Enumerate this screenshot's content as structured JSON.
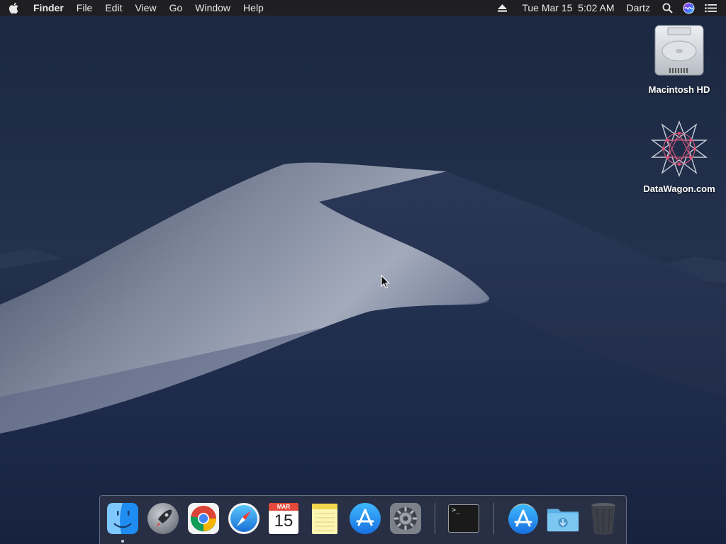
{
  "menubar": {
    "app_name": "Finder",
    "menus": [
      "File",
      "Edit",
      "View",
      "Go",
      "Window",
      "Help"
    ],
    "clock": "Tue Mar 15  5:02 AM",
    "user": "Dartz",
    "icons": [
      "apple-icon",
      "eject-icon",
      "spotlight-search-icon",
      "siri-icon",
      "notification-center-icon"
    ]
  },
  "desktop": {
    "icons": [
      {
        "label": "Macintosh HD",
        "icon": "hard-drive-icon"
      },
      {
        "label": "DataWagon.com",
        "icon": "network-volume-icon"
      }
    ]
  },
  "dock": {
    "items": [
      {
        "name": "Finder",
        "icon": "finder-icon",
        "running": true
      },
      {
        "name": "Launchpad",
        "icon": "launchpad-icon",
        "running": false
      },
      {
        "name": "Google Chrome",
        "icon": "chrome-icon",
        "running": false
      },
      {
        "name": "Safari",
        "icon": "safari-icon",
        "running": false
      },
      {
        "name": "Calendar",
        "icon": "calendar-icon",
        "running": false,
        "month": "MAR",
        "day": "15"
      },
      {
        "name": "Notes",
        "icon": "notes-icon",
        "running": false
      },
      {
        "name": "App Store",
        "icon": "app-store-icon",
        "running": false
      },
      {
        "name": "System Preferences",
        "icon": "gear-icon",
        "running": false
      },
      {
        "name": "Terminal",
        "icon": "terminal-icon",
        "running": false,
        "prompt": ">_"
      },
      {
        "name": "Applications",
        "icon": "applications-stack-icon",
        "running": false
      },
      {
        "name": "Downloads",
        "icon": "downloads-folder-icon",
        "running": false
      },
      {
        "name": "Trash",
        "icon": "trash-icon",
        "running": false
      }
    ]
  },
  "colors": {
    "menubar_bg": "#1f1f22",
    "menubar_text": "#e9e9ea",
    "sky_top": "#1b2740",
    "sky_bottom": "#24324f",
    "dune_light": "#8a93a6",
    "dune_shadow": "#1d2a47"
  }
}
